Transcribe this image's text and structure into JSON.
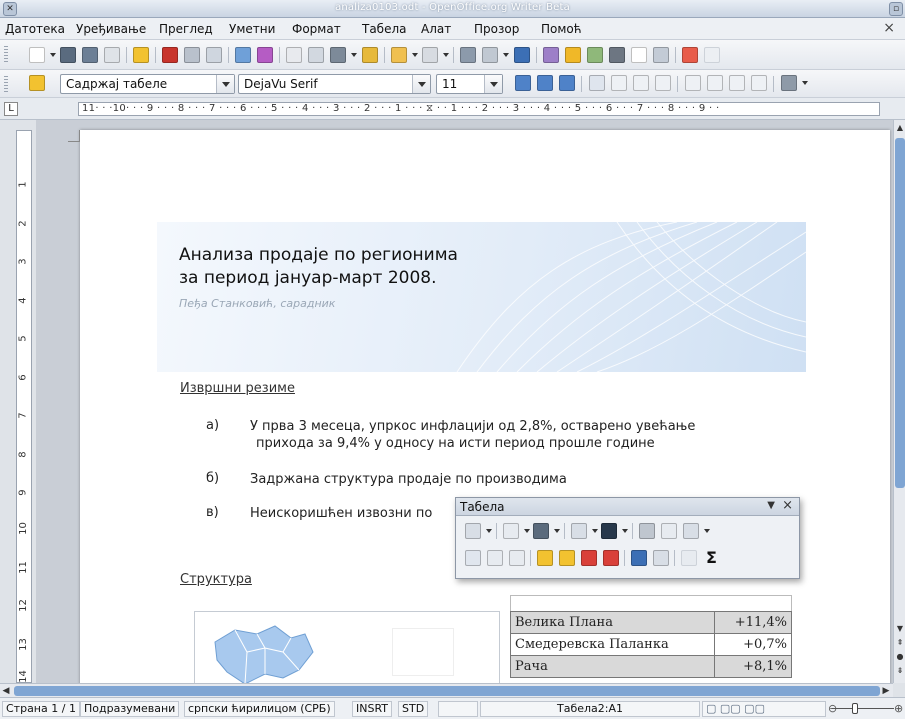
{
  "window": {
    "title": "analiza0103.odt - OpenOffice.org Writer Beta"
  },
  "menubar": {
    "items": [
      "Датотека",
      "Уређивање",
      "Преглед",
      "Уметни",
      "Формат",
      "Табела",
      "Алат",
      "Прозор",
      "Помоћ"
    ],
    "close_glyph": "×"
  },
  "formatting": {
    "paragraph_style": "Садржај табеле",
    "font_name": "DejaVu Serif",
    "font_size": "11"
  },
  "ruler": {
    "horizontal": "11· · ·10· · · 9 · · · 8 · · · 7 · · · 6 · · · 5 · · · 4 · · · 3 · · · 2 · · · 1 · · · ⧖ · · 1 · · · 2 · · · 3 · · · 4 · · · 5 · · · 6 · · · 7 · · · 8 · · · 9 · ·",
    "vertical_numbers": [
      "1",
      "2",
      "3",
      "4",
      "5",
      "6",
      "7",
      "8",
      "9",
      "10",
      "11",
      "12",
      "13",
      "14"
    ]
  },
  "document": {
    "title_line1": "Анализа продаје по регионима",
    "title_line2": "за период јануар-март 2008.",
    "author": "Пеђа Станковић, сарадник",
    "summary_heading": "Извршни резиме",
    "list": [
      {
        "marker": "а)",
        "line1": "У прва 3 месеца, упркос инфлацији од 2,8%, остварено увећање",
        "line2": "прихода за 9,4% у односу на исти период прошле године"
      },
      {
        "marker": "б)",
        "line1": "Задржана структура продаје по производима",
        "line2": ""
      },
      {
        "marker": "в)",
        "line1": "Неискоришћен извозни по",
        "line2": ""
      }
    ],
    "structure_heading": "Структура",
    "table_rows": [
      {
        "name": "Велика Плана",
        "value": "+11,4%"
      },
      {
        "name": "Смедеревска Паланка",
        "value": "+0,7%"
      },
      {
        "name": "Рача",
        "value": "+8,1%"
      }
    ]
  },
  "table_toolbar": {
    "title": "Табела",
    "menu_glyph": "▼",
    "close_glyph": "×",
    "sum_glyph": "Σ"
  },
  "statusbar": {
    "page": "Страна 1 / 1",
    "page_style": "Подразумевани",
    "language": "српски ћирилицом (СРБ)",
    "insert_mode": "INSRT",
    "selection_mode": "STD",
    "cell": "Табела2:А1"
  },
  "colors": {
    "accent": "#7fa5d3",
    "banner": "#dbe7f5",
    "table_shade": "#d9d9d9"
  }
}
